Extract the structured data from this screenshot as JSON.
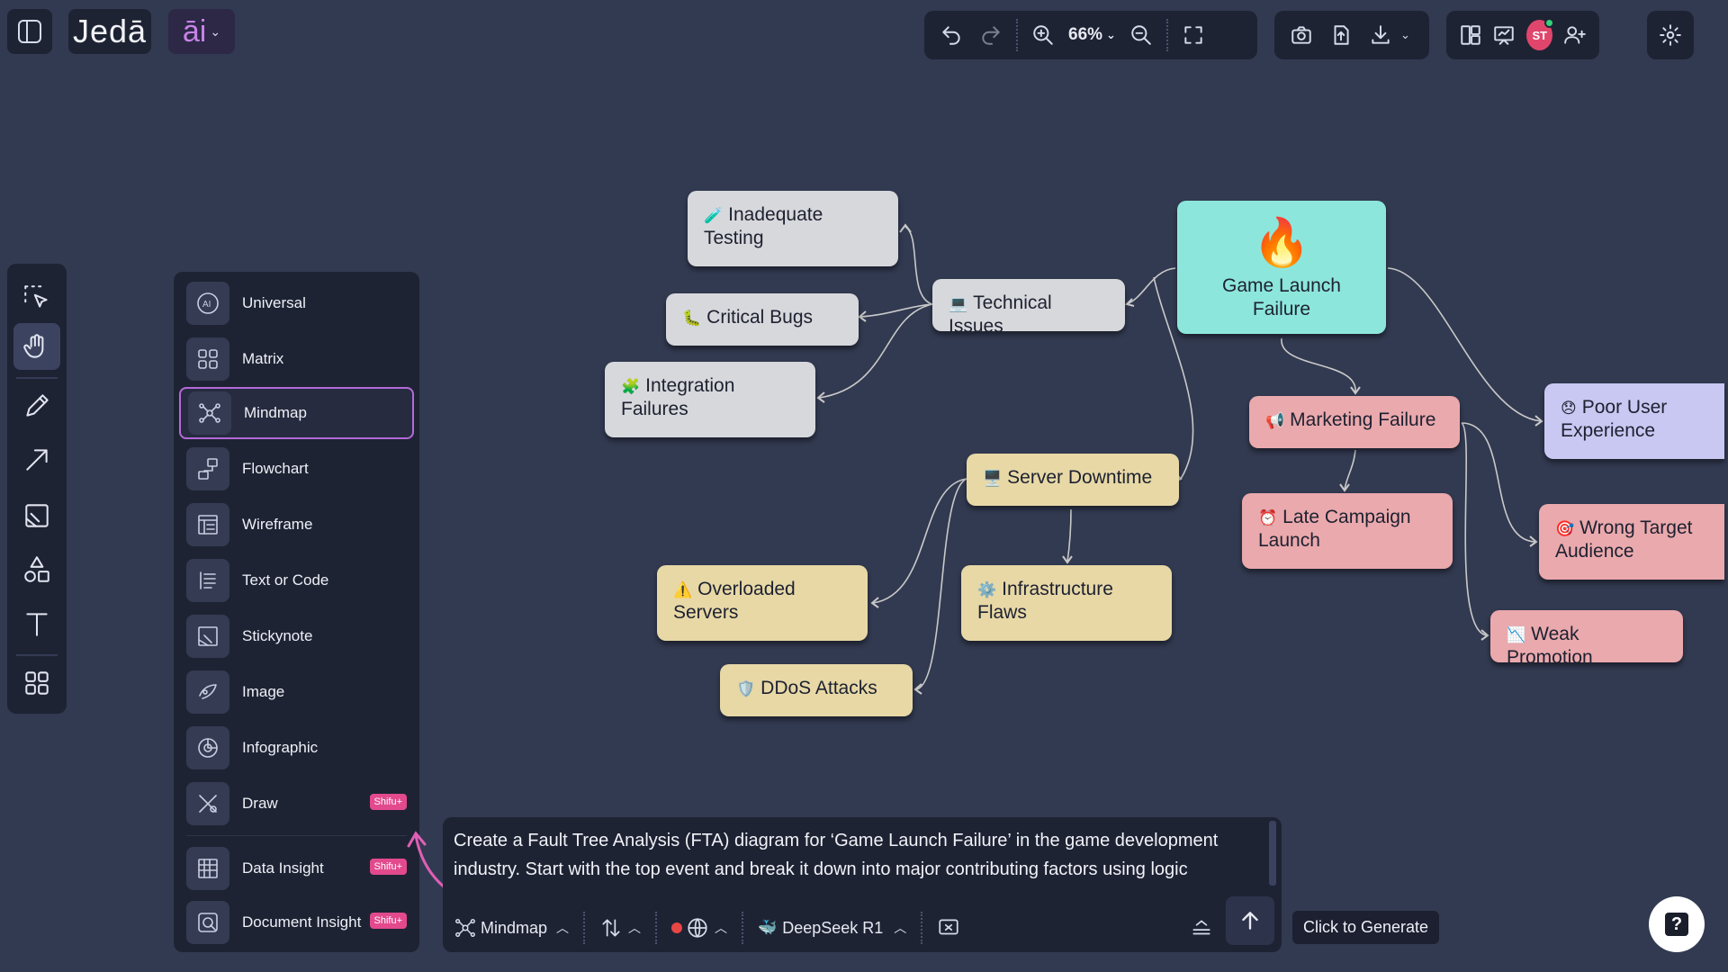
{
  "brand": {
    "logo": "Jedā",
    "ai": "āi"
  },
  "toolbar": {
    "zoom": "66%"
  },
  "avatar": {
    "initials": "ST"
  },
  "type_menu": {
    "items": [
      {
        "label": "Universal",
        "icon": "ai-icon"
      },
      {
        "label": "Matrix",
        "icon": "matrix-icon"
      },
      {
        "label": "Mindmap",
        "icon": "mindmap-icon",
        "selected": true
      },
      {
        "label": "Flowchart",
        "icon": "flowchart-icon"
      },
      {
        "label": "Wireframe",
        "icon": "wireframe-icon"
      },
      {
        "label": "Text or Code",
        "icon": "text-code-icon"
      },
      {
        "label": "Stickynote",
        "icon": "stickynote-icon"
      },
      {
        "label": "Image",
        "icon": "image-icon"
      },
      {
        "label": "Infographic",
        "icon": "infographic-icon"
      },
      {
        "label": "Draw",
        "icon": "draw-icon",
        "badge": "Shifu+"
      },
      {
        "label": "Data Insight",
        "icon": "data-insight-icon",
        "badge": "Shifu+"
      },
      {
        "label": "Document Insight",
        "icon": "document-insight-icon",
        "badge": "Shifu+"
      }
    ]
  },
  "mindmap": {
    "root": {
      "emoji": "🔥",
      "label": "Game Launch Failure"
    },
    "nodes": {
      "inadequate_testing": {
        "emoji": "🧪",
        "label": "Inadequate Testing"
      },
      "critical_bugs": {
        "emoji": "🐛",
        "label": "Critical Bugs"
      },
      "integration_failures": {
        "emoji": "🧩",
        "label": "Integration Failures"
      },
      "technical_issues": {
        "emoji": "💻",
        "label": "Technical Issues"
      },
      "server_downtime": {
        "emoji": "🖥️",
        "label": "Server Downtime"
      },
      "overloaded_servers": {
        "emoji": "⚠️",
        "label": "Overloaded Servers"
      },
      "infrastructure_flaws": {
        "emoji": "⚙️",
        "label": "Infrastructure Flaws"
      },
      "ddos_attacks": {
        "emoji": "🛡️",
        "label": "DDoS Attacks"
      },
      "marketing_failure": {
        "emoji": "📢",
        "label": "Marketing Failure"
      },
      "late_campaign": {
        "emoji": "⏰",
        "label": "Late Campaign Launch"
      },
      "poor_ux": {
        "emoji": "😞",
        "label": "Poor User Experience"
      },
      "wrong_audience": {
        "emoji": "🎯",
        "label": "Wrong Target Audience"
      },
      "weak_promotion": {
        "emoji": "📉",
        "label": "Weak Promotion"
      }
    }
  },
  "prompt": {
    "text": "Create a Fault Tree Analysis (FTA) diagram for ‘Game Launch Failure’ in the game development industry. Start with the top event and break it down into major contributing factors using logic",
    "mode": "Mindmap",
    "model": "DeepSeek R1"
  },
  "tooltip": "Click to Generate",
  "help": "?"
}
